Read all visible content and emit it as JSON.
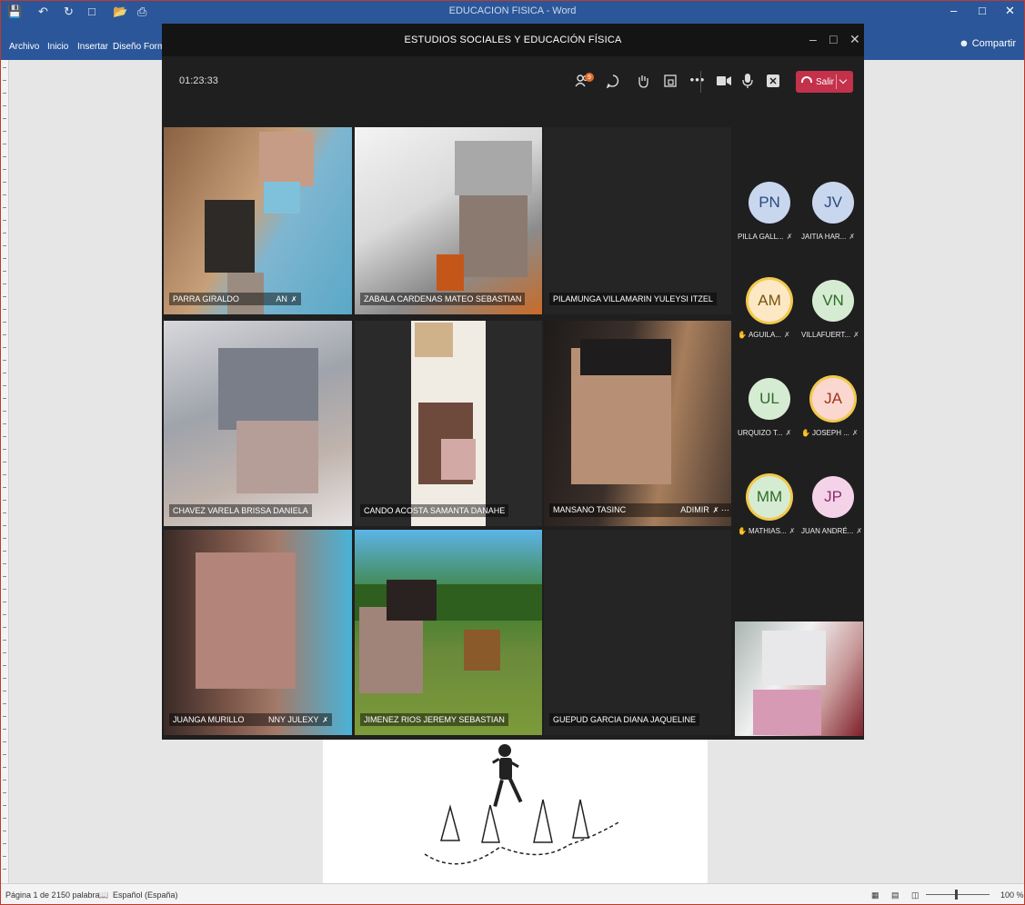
{
  "word": {
    "title": "EDUCACION FISICA - Word",
    "ribbon_tabs": [
      "Archivo",
      "Inicio",
      "Insertar",
      "Diseño",
      "Form"
    ],
    "share_label": "Compartir",
    "status": {
      "page": "Página 1 de 2",
      "words": "150 palabras",
      "language": "Español (España)",
      "zoom": "100 %"
    }
  },
  "meeting": {
    "title": "ESTUDIOS SOCIALES Y EDUCACIÓN FÍSICA",
    "timer": "01:23:33",
    "leave_label": "Salir",
    "participants_badge": "9",
    "colors": {
      "leave": "#c4314b",
      "hand_raise": "#f2c94c",
      "background": "#1f1f1f"
    },
    "tiles": [
      {
        "name": "PARRA GIRALDO",
        "name_suffix": "AN"
      },
      {
        "name": "ZABALA CARDENAS MATEO SEBASTIAN"
      },
      {
        "name": "PILAMUNGA VILLAMARIN YULEYSI ITZEL"
      },
      {
        "name": "CHAVEZ VARELA BRISSA DANIELA"
      },
      {
        "name": "CANDO ACOSTA SAMANTA DANAHE"
      },
      {
        "name": "MANSANO TASINC",
        "name_suffix": "ADIMIR"
      },
      {
        "name": "JUANGA MURILLO",
        "name_suffix": "NNY JULEXY"
      },
      {
        "name": "JIMENEZ RIOS JEREMY SEBASTIAN"
      },
      {
        "name": "GUEPUD GARCIA DIANA JAQUELINE"
      }
    ],
    "roster": [
      {
        "initials": "PN",
        "name": "PILLA GALL...",
        "hand": false,
        "bg": "#c9d7ee",
        "fg": "#2b4a7e"
      },
      {
        "initials": "JV",
        "name": "JAITIA HAR...",
        "hand": false,
        "bg": "#c9d7ee",
        "fg": "#2b4a7e"
      },
      {
        "initials": "AM",
        "name": "AGUILA...",
        "hand": true,
        "bg": "#fce8c4",
        "fg": "#7a5312"
      },
      {
        "initials": "VN",
        "name": "VILLAFUERT...",
        "hand": false,
        "bg": "#d6ecd2",
        "fg": "#2f6b2a"
      },
      {
        "initials": "UL",
        "name": "URQUIZO T...",
        "hand": false,
        "bg": "#d6ecd2",
        "fg": "#2f6b2a"
      },
      {
        "initials": "JA",
        "name": "Joseph ...",
        "hand": true,
        "bg": "#fbd8cf",
        "fg": "#a1331c"
      },
      {
        "initials": "MM",
        "name": "Mathias...",
        "hand": true,
        "bg": "#d6ecd2",
        "fg": "#2f6b2a"
      },
      {
        "initials": "JP",
        "name": "Juan André...",
        "hand": false,
        "bg": "#f4d3e9",
        "fg": "#8a2c6a"
      }
    ]
  }
}
